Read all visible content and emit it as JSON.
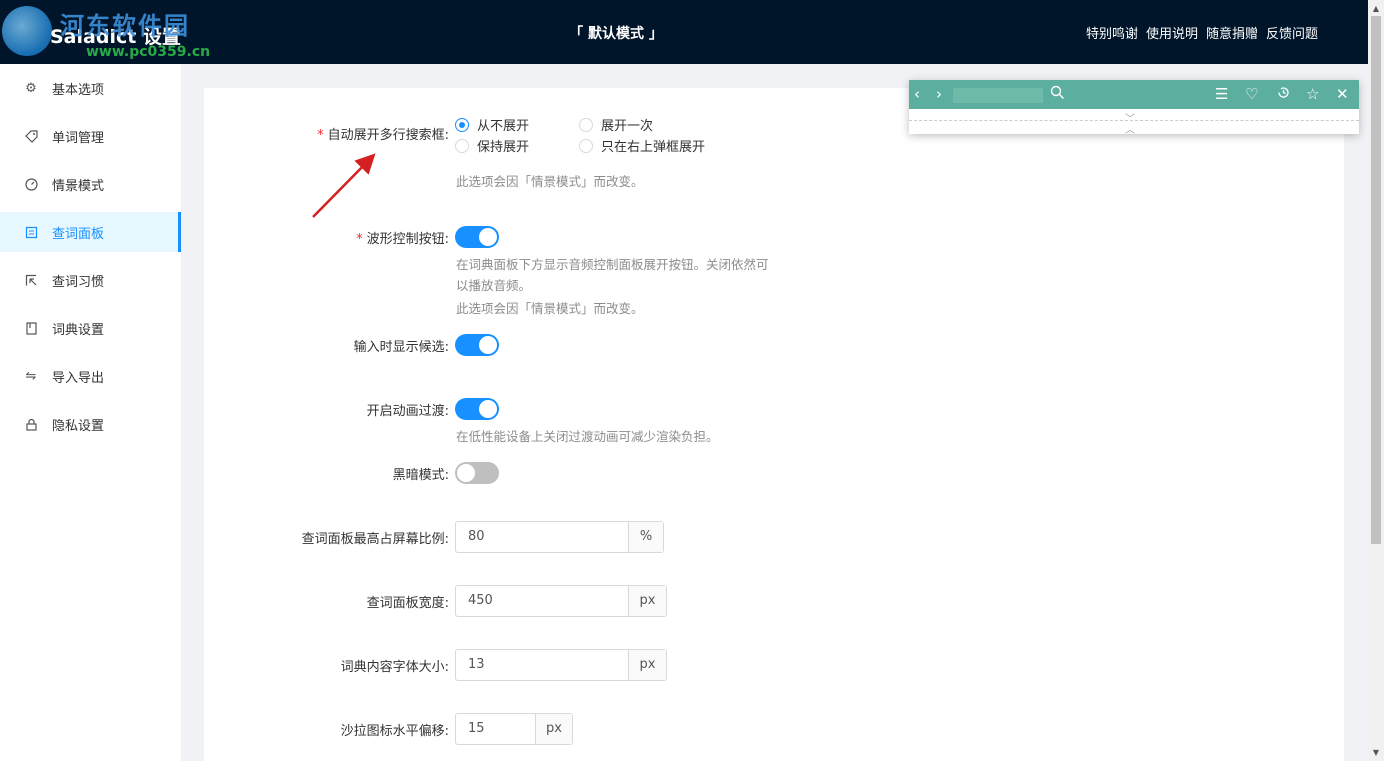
{
  "header": {
    "brand": "Saladict 设置",
    "watermark": "河东软件园",
    "watermark_url": "www.pc0359.cn",
    "mode_title": "「 默认模式 」",
    "links": [
      "特别鸣谢",
      "使用说明",
      "随意捐赠",
      "反馈问题"
    ]
  },
  "sidebar": {
    "items": [
      {
        "label": "基本选项",
        "icon": "gear-icon"
      },
      {
        "label": "单词管理",
        "icon": "tag-icon"
      },
      {
        "label": "情景模式",
        "icon": "dashboard-icon"
      },
      {
        "label": "查词面板",
        "icon": "panel-icon",
        "active": true
      },
      {
        "label": "查词习惯",
        "icon": "select-icon"
      },
      {
        "label": "词典设置",
        "icon": "book-icon"
      },
      {
        "label": "导入导出",
        "icon": "swap-icon"
      },
      {
        "label": "隐私设置",
        "icon": "lock-icon"
      }
    ]
  },
  "form": {
    "expand_mode": {
      "label": "自动展开多行搜索框:",
      "options": [
        "从不展开",
        "展开一次",
        "保持展开",
        "只在右上弹框展开"
      ],
      "selected": "从不展开",
      "help": "此选项会因「情景模式」而改变。"
    },
    "wave_control": {
      "label": "波形控制按钮:",
      "on": true,
      "help1": "在词典面板下方显示音频控制面板展开按钮。关闭依然可",
      "help2": "以播放音频。",
      "help3": "此选项会因「情景模式」而改变。"
    },
    "show_suggest": {
      "label": "输入时显示候选:",
      "on": true
    },
    "animation": {
      "label": "开启动画过渡:",
      "on": true,
      "help": "在低性能设备上关闭过渡动画可减少渲染负担。"
    },
    "dark_mode": {
      "label": "黑暗模式:",
      "on": false
    },
    "max_height": {
      "label": "查词面板最高占屏幕比例:",
      "value": "80",
      "unit": "%"
    },
    "panel_width": {
      "label": "查词面板宽度:",
      "value": "450",
      "unit": "px"
    },
    "font_size": {
      "label": "词典内容字体大小:",
      "value": "13",
      "unit": "px"
    },
    "icon_offset": {
      "label": "沙拉图标水平偏移:",
      "value": "15",
      "unit": "px"
    }
  },
  "colors": {
    "header_bg": "#001529",
    "accent": "#1890ff",
    "dict_bar": "#5caf9e",
    "required": "#f5222d"
  }
}
